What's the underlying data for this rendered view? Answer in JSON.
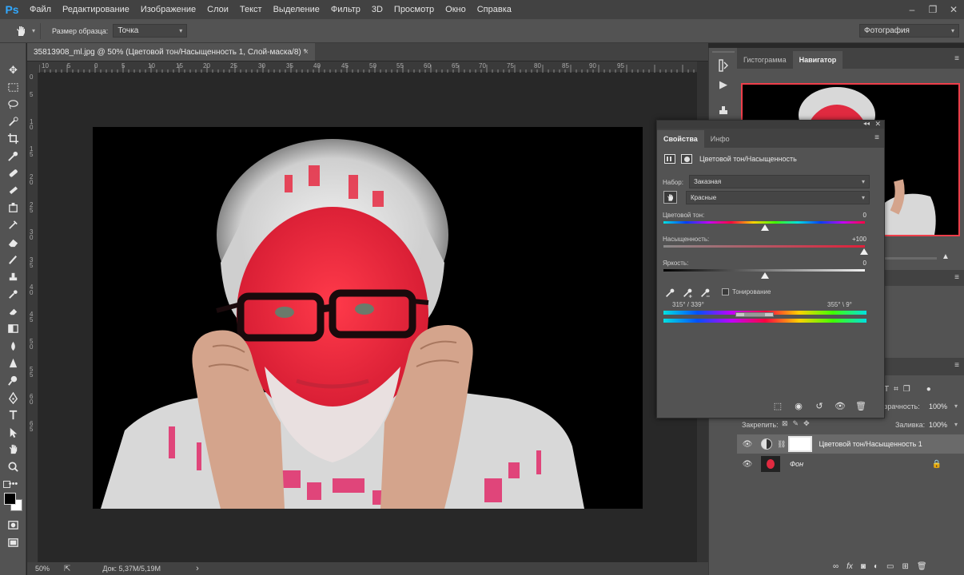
{
  "app": {
    "logo": "Ps",
    "menu": [
      "Файл",
      "Редактирование",
      "Изображение",
      "Слои",
      "Текст",
      "Выделение",
      "Фильтр",
      "3D",
      "Просмотр",
      "Окно",
      "Справка"
    ],
    "window_controls": [
      "–",
      "❐",
      "✕"
    ]
  },
  "options_bar": {
    "sample_size_label": "Размер образца:",
    "sample_size_value": "Точка",
    "workspace": "Фотография"
  },
  "document": {
    "tab_title": "35813908_ml.jpg @ 50% (Цветовой тон/Насыщенность 1, Слой-маска/8) *",
    "close": "×"
  },
  "rulers": {
    "horizontal": [
      "10",
      "5",
      "0",
      "5",
      "10",
      "15",
      "20",
      "25",
      "30",
      "35",
      "40",
      "45",
      "50",
      "55",
      "60",
      "65",
      "70",
      "75",
      "80",
      "85",
      "90",
      "95"
    ],
    "vertical": [
      "0",
      "5",
      "1 0",
      "1 5",
      "2 0",
      "2 5",
      "3 0",
      "3 5",
      "4 0",
      "4 5",
      "5 0",
      "5 5",
      "6 0",
      "6 5"
    ]
  },
  "status": {
    "zoom": "50%",
    "doc_info": "Док: 5,37M/5,19M",
    "arrow": "›"
  },
  "right_panel": {
    "top_tabs": [
      "Гистограмма",
      "Навигатор"
    ],
    "active_top_tab": "Навигатор",
    "opacity_label": "Непрозрачность:",
    "opacity_value": "100%",
    "fill_label": "Заливка:",
    "fill_value": "100%",
    "lock_label": "Закрепить:",
    "layers": [
      {
        "name": "Цветовой тон/Насыщенность 1",
        "visible": true,
        "selected": true
      },
      {
        "name": "Фон",
        "visible": true,
        "locked": true
      }
    ]
  },
  "properties": {
    "tabs": [
      "Свойства",
      "Инфо"
    ],
    "active_tab": "Свойства",
    "title": "Цветовой тон/Насыщенность",
    "preset_label": "Набор:",
    "preset_value": "Заказная",
    "channel_value": "Красные",
    "hue_label": "Цветовой тон:",
    "hue_value": "0",
    "saturation_label": "Насыщенность:",
    "saturation_value": "+100",
    "lightness_label": "Яркость:",
    "lightness_value": "0",
    "colorize_label": "Тонирование",
    "range_left": "315° / 339°",
    "range_right": "355° \\ 9°"
  }
}
